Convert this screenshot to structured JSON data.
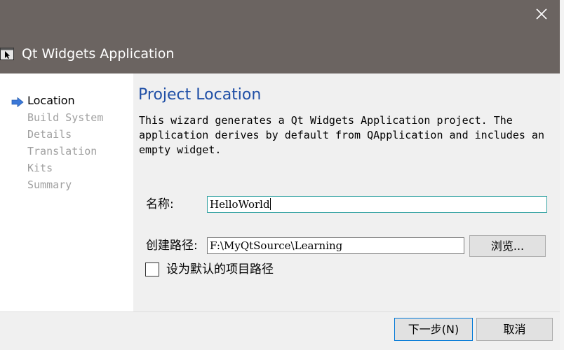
{
  "window": {
    "title": "Qt Widgets Application",
    "close_icon": "close-icon",
    "app_icon": "qt-creator-icon"
  },
  "sidebar": {
    "current_marker_icon": "arrow-right-icon",
    "steps": [
      {
        "label": "Location",
        "current": true
      },
      {
        "label": "Build System",
        "current": false
      },
      {
        "label": "Details",
        "current": false
      },
      {
        "label": "Translation",
        "current": false
      },
      {
        "label": "Kits",
        "current": false
      },
      {
        "label": "Summary",
        "current": false
      }
    ]
  },
  "main": {
    "heading": "Project Location",
    "intro": "This wizard generates a Qt Widgets Application project. The application derives by default from QApplication and includes an empty widget.",
    "name_label": "名称:",
    "name_value": "HelloWorld",
    "path_label": "创建路径:",
    "path_value": "F:\\MyQtSource\\Learning",
    "browse_label": "浏览...",
    "default_path_label": "设为默认的项目路径",
    "default_path_checked": false
  },
  "footer": {
    "next_label": "下一步(N)",
    "cancel_label": "取消"
  },
  "colors": {
    "titlebar": "#6b6461",
    "heading": "#1f4fa6",
    "arrow": "#3b78d8",
    "focus_border": "#36a3a3",
    "default_button_border": "#0078d7"
  }
}
